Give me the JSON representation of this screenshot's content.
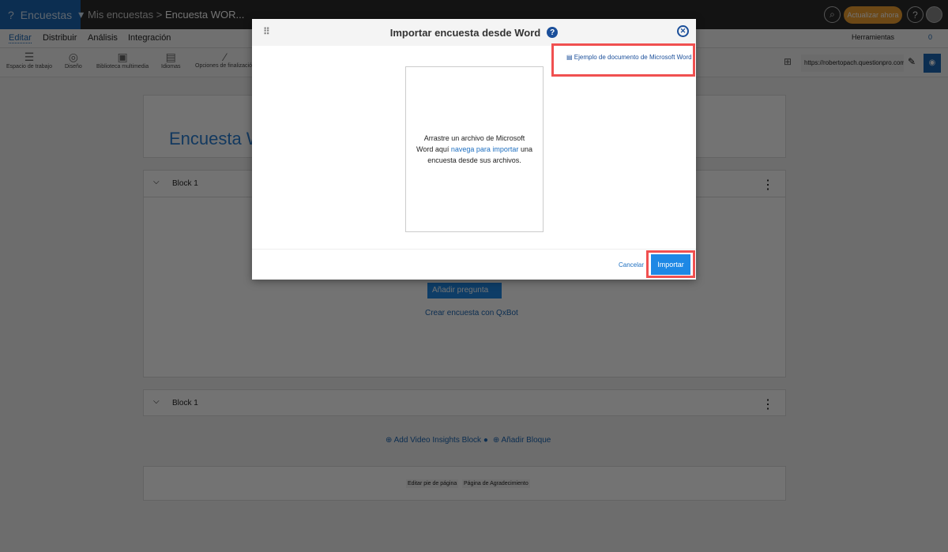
{
  "topbar": {
    "brand": "Encuestas",
    "crumb_root": "Mis encuestas",
    "crumb_sep": ">",
    "crumb_current": "Encuesta WOR...",
    "upgrade": "Actualizar ahora",
    "help": "?"
  },
  "tabs": [
    "Editar",
    "Distribuir",
    "Análisis",
    "Integración"
  ],
  "tools_menu": "Herramientas",
  "collab_count": "0",
  "toolbar": [
    "Espacio de trabajo",
    "Diseño",
    "Biblioteca multimedia",
    "Idiomas",
    "Opciones de finalización"
  ],
  "survey_url": "https://robertopach.questionpro.com",
  "survey": {
    "title": "Encuesta WORD",
    "block1": "Block 1",
    "block2": "Block 1",
    "add_question": "Añadir pregunta",
    "qxbot": "Crear encuesta con QxBot",
    "add_video": "Add Video Insights Block",
    "add_block": "Añadir Bloque",
    "footer_edit": "Editar pie de página",
    "thanks_page": "Página de Agradecimiento"
  },
  "modal": {
    "title": "Importar encuesta desde Word",
    "sample_link": "Ejemplo de documento de Microsoft Word",
    "drop_text_1": "Arrastre un archivo de Microsoft Word aquí ",
    "drop_link": "navega para importar",
    "drop_text_2": " una encuesta desde sus archivos.",
    "cancel": "Cancelar",
    "import": "Importar"
  }
}
